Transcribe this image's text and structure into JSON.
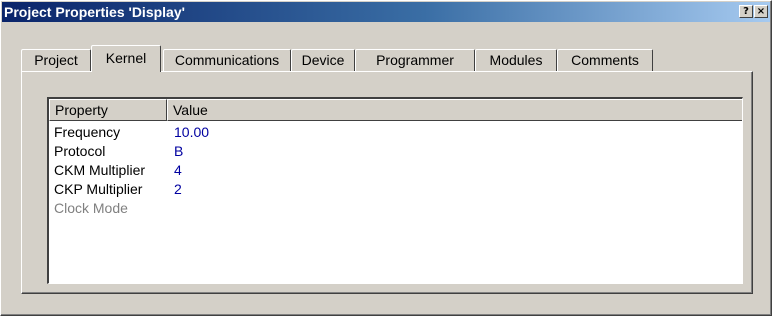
{
  "window": {
    "title": "Project Properties 'Display'",
    "help_glyph": "?",
    "close_glyph": "×"
  },
  "tabs": [
    {
      "label": "Project",
      "active": false
    },
    {
      "label": "Kernel",
      "active": true
    },
    {
      "label": "Communications",
      "active": false
    },
    {
      "label": "Device",
      "active": false
    },
    {
      "label": "Programmer",
      "active": false
    },
    {
      "label": "Modules",
      "active": false
    },
    {
      "label": "Comments",
      "active": false
    }
  ],
  "listview": {
    "columns": [
      "Property",
      "Value"
    ],
    "rows": [
      {
        "property": "Frequency",
        "value": "10.00",
        "enabled": true
      },
      {
        "property": "Protocol",
        "value": "B",
        "enabled": true
      },
      {
        "property": "CKM Multiplier",
        "value": "4",
        "enabled": true
      },
      {
        "property": "CKP Multiplier",
        "value": "2",
        "enabled": true
      },
      {
        "property": "Clock Mode",
        "value": "",
        "enabled": false
      }
    ]
  },
  "colors": {
    "title_gradient_start": "#0a246a",
    "title_gradient_end": "#a6caf0",
    "face": "#d4d0c8",
    "value_text": "#0000a0",
    "disabled_text": "#808080"
  }
}
